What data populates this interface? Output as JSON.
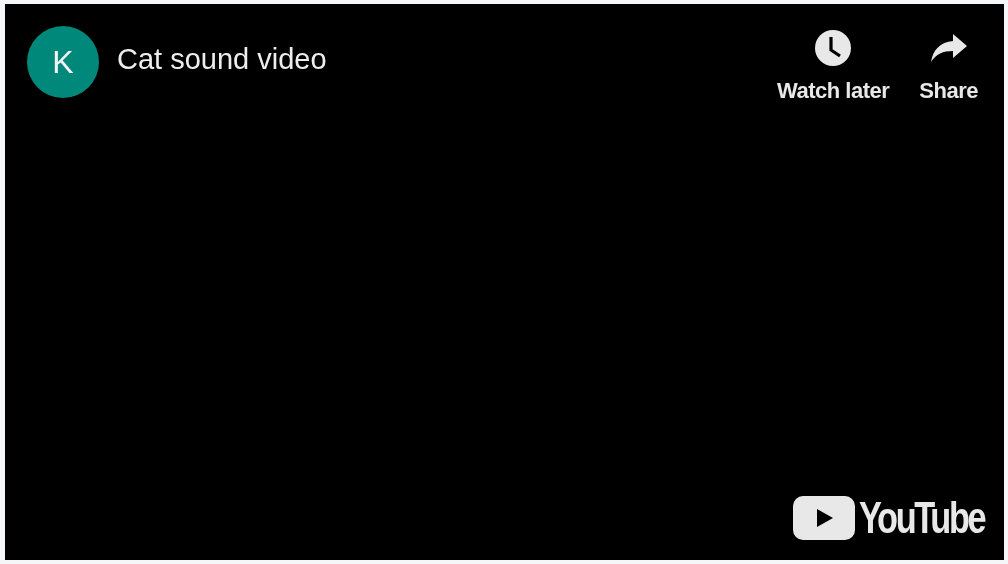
{
  "channel": {
    "avatar_letter": "K"
  },
  "video": {
    "title": "Cat sound video"
  },
  "actions": [
    {
      "label": "Watch later",
      "kind": "clock"
    },
    {
      "label": "Share",
      "kind": "share"
    }
  ],
  "logo": {
    "text": "YouTube"
  }
}
